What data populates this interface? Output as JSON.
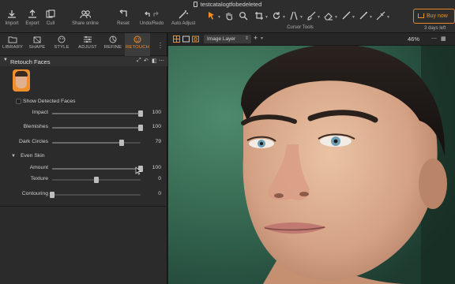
{
  "document": {
    "title": "testcatalogtfobedeleted"
  },
  "toolbar": {
    "import": "Import",
    "export": "Export",
    "cull": "Cull",
    "share": "Share online",
    "reset": "Reset",
    "undo_redo": "Undo/Redo",
    "auto_adjust": "Auto Adjust",
    "cursor_tools": "Cursor Tools",
    "buy": "Buy now",
    "days_left": "3 days left"
  },
  "tabs": [
    "LIBRARY",
    "SHAPE",
    "STYLE",
    "ADJUST",
    "REFINE",
    "RETOUCH"
  ],
  "active_tab": "RETOUCH",
  "retouch": {
    "title": "Retouch Faces",
    "show_faces": "Show Detected Faces",
    "sliders": [
      {
        "label": "Impact",
        "value": "100",
        "level": 1.0
      },
      {
        "label": "Blemishes",
        "value": "100",
        "level": 1.0
      },
      {
        "label": "Dark Circles",
        "value": "79",
        "level": 0.79
      }
    ],
    "even_skin": {
      "title": "Even Skin",
      "sliders": [
        {
          "label": "Amount",
          "value": "100",
          "level": 1.0
        },
        {
          "label": "Texture",
          "value": "0",
          "level": 0.5
        },
        {
          "label": "Contouring",
          "value": "0",
          "level": 0.0
        }
      ]
    }
  },
  "viewer": {
    "layer": "Image Layer",
    "zoom": "46%"
  },
  "colors": {
    "accent": "#f08e2a",
    "background_green": "#2f5e4a"
  }
}
